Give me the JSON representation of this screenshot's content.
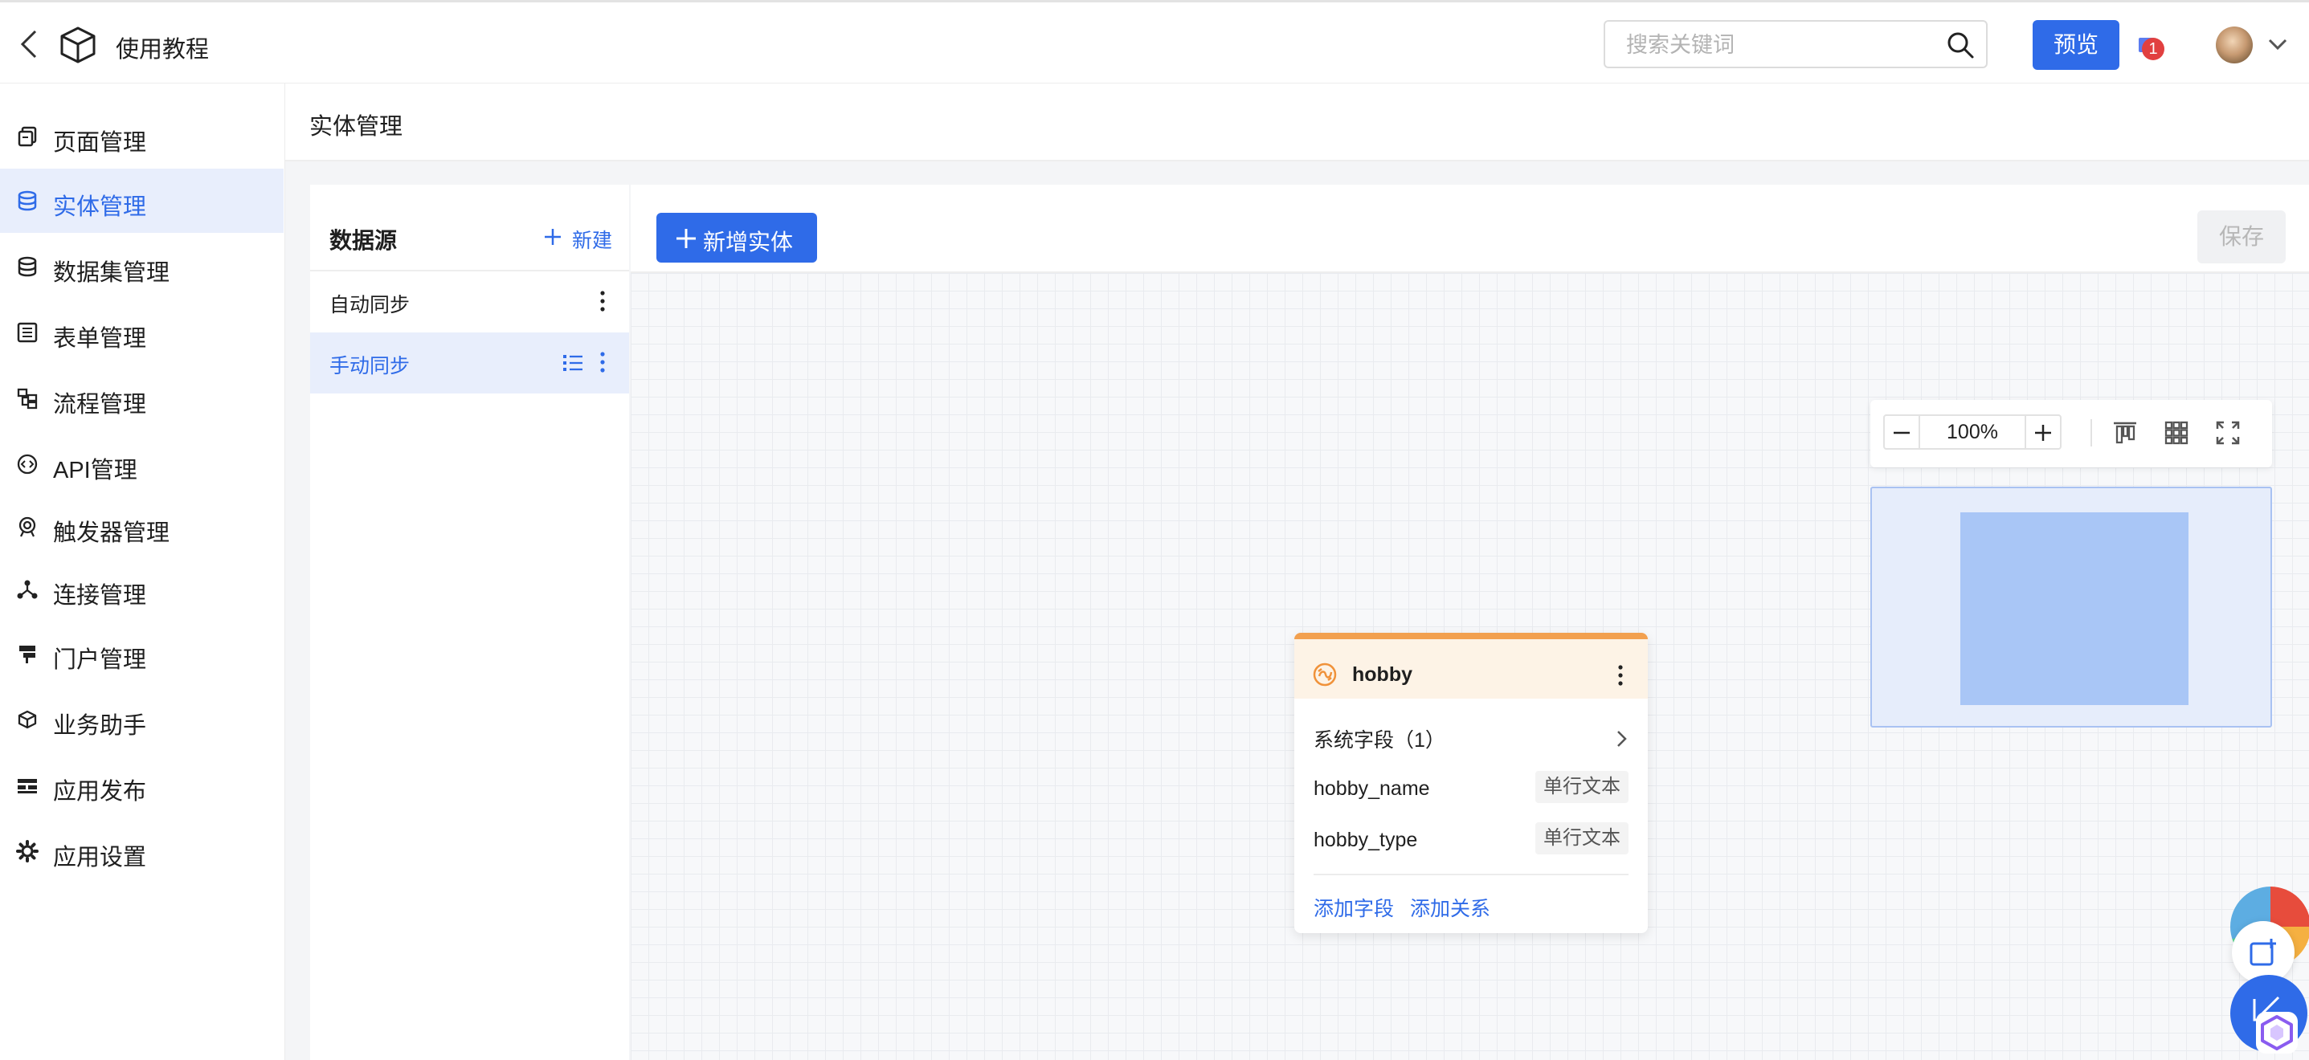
{
  "header": {
    "app_title": "使用教程",
    "search_placeholder": "搜索关键词",
    "preview_label": "预览",
    "notification_count": "1"
  },
  "sidebar": {
    "items": [
      {
        "label": "页面管理",
        "icon": "pages-icon"
      },
      {
        "label": "实体管理",
        "icon": "database-icon",
        "active": true
      },
      {
        "label": "数据集管理",
        "icon": "dataset-icon"
      },
      {
        "label": "表单管理",
        "icon": "form-icon"
      },
      {
        "label": "流程管理",
        "icon": "flow-icon"
      },
      {
        "label": "API管理",
        "icon": "api-icon"
      },
      {
        "label": "触发器管理",
        "icon": "trigger-icon"
      },
      {
        "label": "连接管理",
        "icon": "connection-icon"
      },
      {
        "label": "门户管理",
        "icon": "portal-icon"
      },
      {
        "label": "业务助手",
        "icon": "assistant-icon"
      },
      {
        "label": "应用发布",
        "icon": "publish-icon"
      },
      {
        "label": "应用设置",
        "icon": "gear-icon"
      }
    ]
  },
  "page": {
    "title": "实体管理"
  },
  "datasource": {
    "title": "数据源",
    "new_label": "新建",
    "items": [
      {
        "label": "自动同步"
      },
      {
        "label": "手动同步",
        "active": true
      }
    ]
  },
  "canvas": {
    "add_entity_label": "新增实体",
    "save_label": "保存",
    "zoom": "100%"
  },
  "entity": {
    "name": "hobby",
    "system_fields_label": "系统字段（1）",
    "fields": [
      {
        "name": "hobby_name",
        "type": "单行文本"
      },
      {
        "name": "hobby_type",
        "type": "单行文本"
      }
    ],
    "add_field_label": "添加字段",
    "add_relation_label": "添加关系"
  },
  "colors": {
    "accent": "#2f6be8",
    "active_bg": "#e8eefc",
    "entity_header": "#fdf3e6",
    "entity_top": "#f2a04f"
  }
}
